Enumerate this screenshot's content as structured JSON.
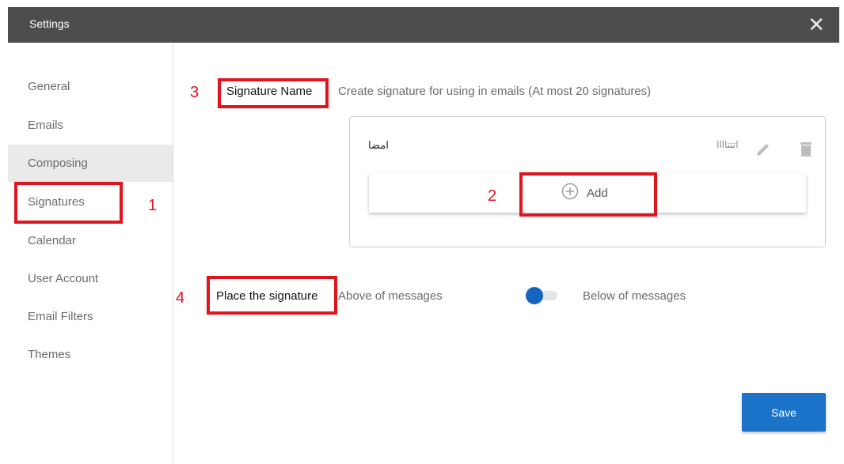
{
  "window": {
    "title": "Settings",
    "close_icon": "close-icon"
  },
  "sidebar": {
    "items": [
      {
        "label": "General"
      },
      {
        "label": "Emails"
      },
      {
        "label": "Composing",
        "highlighted": true
      },
      {
        "label": "Signatures",
        "selected": true
      },
      {
        "label": "Calendar"
      },
      {
        "label": "User Account"
      },
      {
        "label": "Email Filters"
      },
      {
        "label": "Themes"
      }
    ]
  },
  "annotations": {
    "marker_1": "1",
    "marker_2": "2",
    "marker_3": "3",
    "marker_4": "4",
    "color": "#e0141d"
  },
  "signature_section": {
    "label": "Signature Name",
    "description": "Create signature for using in emails (At most 20 signatures)",
    "signatures": [
      {
        "name": "امضا",
        "text": "اتتتاااا"
      }
    ],
    "add_label": "Add"
  },
  "placement": {
    "label": "Place the signature",
    "option_left": "Above of messages",
    "option_right": "Below of messages",
    "toggle_state": "above"
  },
  "actions": {
    "save_label": "Save"
  },
  "colors": {
    "titlebar": "#4d4d4d",
    "accent": "#1a73c9",
    "toggle_knob": "#1565c0"
  }
}
